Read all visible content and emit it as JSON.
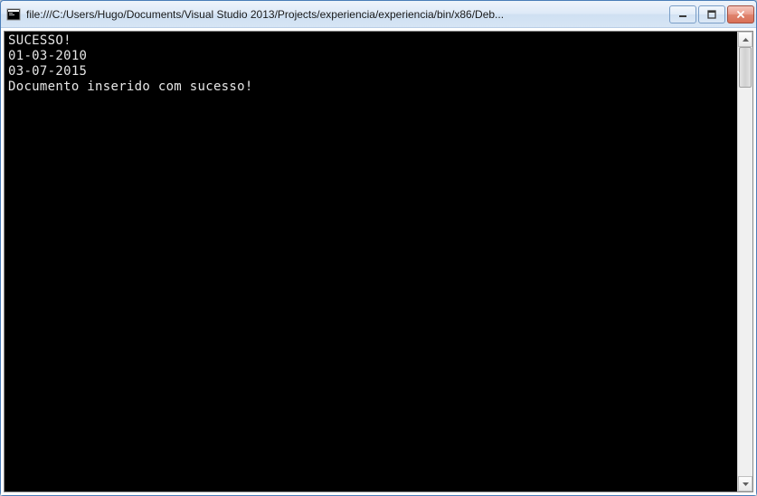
{
  "window": {
    "title": "file:///C:/Users/Hugo/Documents/Visual Studio 2013/Projects/experiencia/experiencia/bin/x86/Deb..."
  },
  "console": {
    "lines": [
      "SUCESSO!",
      "01-03-2010",
      "03-07-2015",
      "Documento inserido com sucesso!"
    ]
  }
}
